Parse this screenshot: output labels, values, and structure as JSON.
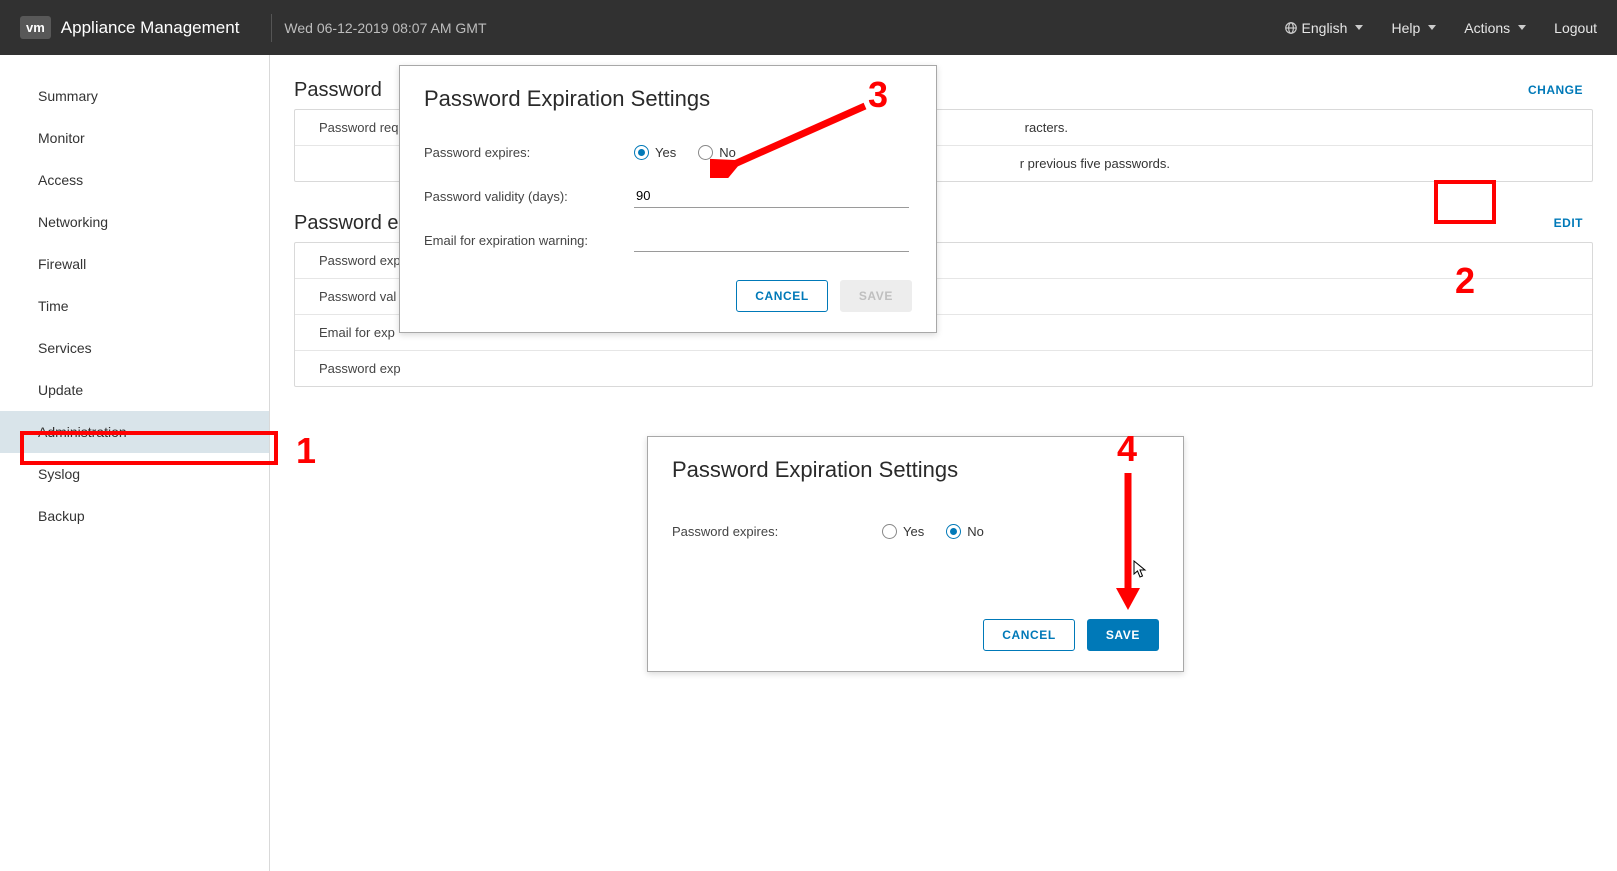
{
  "header": {
    "brand": "vm",
    "app_title": "Appliance Management",
    "timestamp": "Wed 06-12-2019 08:07 AM GMT",
    "language": "English",
    "help": "Help",
    "actions": "Actions",
    "logout": "Logout"
  },
  "sidebar": {
    "items": [
      {
        "label": "Summary"
      },
      {
        "label": "Monitor"
      },
      {
        "label": "Access"
      },
      {
        "label": "Networking"
      },
      {
        "label": "Firewall"
      },
      {
        "label": "Time"
      },
      {
        "label": "Services"
      },
      {
        "label": "Update"
      },
      {
        "label": "Administration",
        "active": true
      },
      {
        "label": "Syslog"
      },
      {
        "label": "Backup"
      }
    ]
  },
  "sections": {
    "password": {
      "title": "Password",
      "action": "CHANGE",
      "rows": [
        {
          "label": "Password req",
          "tail": "racters."
        },
        {
          "tail": "r previous five passwords."
        }
      ]
    },
    "expiration": {
      "title": "Password exp",
      "action": "EDIT",
      "rows": [
        {
          "label": "Password exp"
        },
        {
          "label": "Password val"
        },
        {
          "label": "Email for exp"
        },
        {
          "label": "Password exp"
        }
      ]
    }
  },
  "dialog1": {
    "title": "Password Expiration Settings",
    "expires_label": "Password expires:",
    "yes": "Yes",
    "no": "No",
    "validity_label": "Password validity (days):",
    "validity_value": "90",
    "email_label": "Email for expiration warning:",
    "email_value": "",
    "cancel": "CANCEL",
    "save": "SAVE"
  },
  "dialog2": {
    "title": "Password Expiration Settings",
    "expires_label": "Password expires:",
    "yes": "Yes",
    "no": "No",
    "cancel": "CANCEL",
    "save": "SAVE"
  },
  "annotations": {
    "n1": "1",
    "n2": "2",
    "n3": "3",
    "n4": "4"
  }
}
